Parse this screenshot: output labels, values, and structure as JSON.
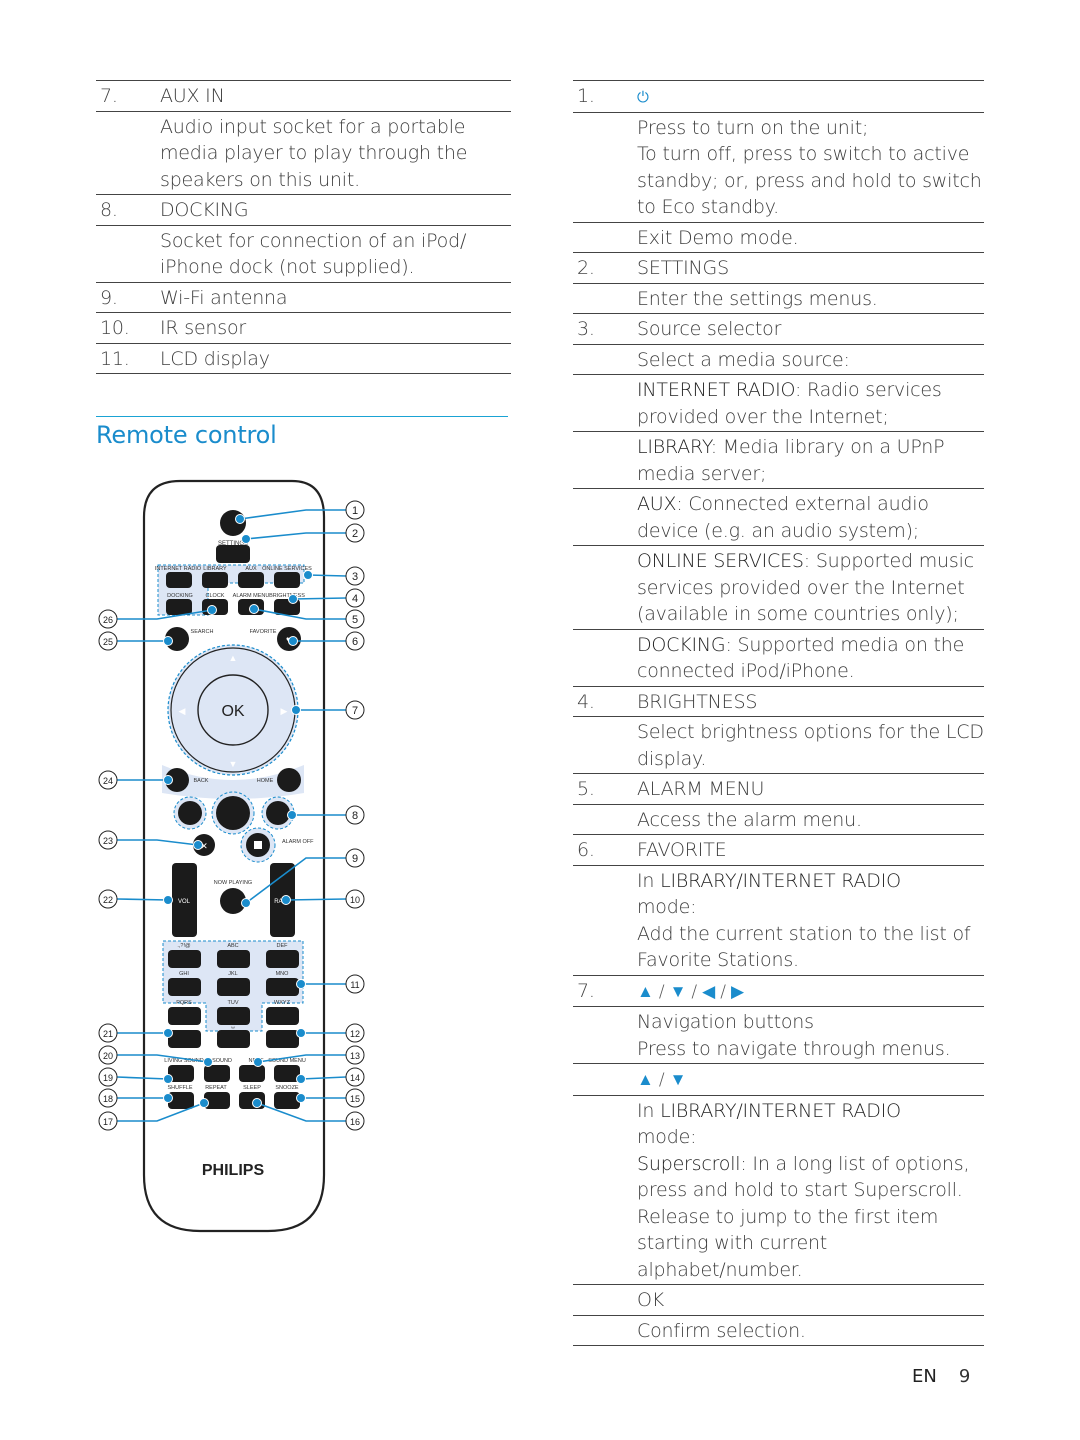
{
  "left_table": [
    {
      "num": "7.",
      "title": "AUX IN",
      "desc": [
        "Audio input socket for a portable",
        "media player to play through the",
        "speakers on this unit."
      ]
    },
    {
      "num": "8.",
      "title": "DOCKING",
      "desc": [
        "Socket for connection of an iPod/",
        "iPhone dock (not supplied)."
      ]
    },
    {
      "num": "9.",
      "title": "Wi-Fi antenna"
    },
    {
      "num": "10.",
      "title": "IR sensor"
    },
    {
      "num": "11.",
      "title": "LCD display"
    }
  ],
  "section": {
    "title": "Remote control"
  },
  "right_table": {
    "r1": {
      "num": "1.",
      "icon": "power-icon",
      "desc": [
        "Press to turn on the unit;",
        "To turn off, press to switch to active",
        "standby; or, press and hold to switch",
        "to Eco standby."
      ],
      "desc2": "Exit Demo mode."
    },
    "r2": {
      "num": "2.",
      "title": "SETTINGS",
      "desc": "Enter the settings menus."
    },
    "r3": {
      "num": "3.",
      "title": "Source selector",
      "desc": "Select a media source:",
      "sources": [
        {
          "key": "INTERNET RADIO",
          "text": ": Radio services",
          "text2": "provided over the Internet;"
        },
        {
          "key": "LIBRARY",
          "text": ": Media library on a UPnP",
          "text2": "media server;"
        },
        {
          "key": "AUX",
          "text": ": Connected external audio",
          "text2": "device (e.g. an audio system);"
        },
        {
          "key": "ONLINE SERVICES",
          "text": ": Supported music",
          "text2": "services provided over the Internet",
          "text3": "(available in some countries only);"
        },
        {
          "key": "DOCKING",
          "text": ": Supported media on the",
          "text2": "connected iPod/iPhone."
        }
      ]
    },
    "r4": {
      "num": "4.",
      "title": "BRIGHTNESS",
      "desc": [
        "Select brightness options for the LCD",
        "display."
      ]
    },
    "r5": {
      "num": "5.",
      "title": "ALARM MENU",
      "desc": "Access the alarm menu."
    },
    "r6": {
      "num": "6.",
      "title": "FAVORITE",
      "in": "In ",
      "mode_key": "LIBRARY/INTERNET RADIO",
      "mode": "mode:",
      "desc": [
        "Add the current station to the list of",
        "Favorite Stations."
      ]
    },
    "r7": {
      "num": "7.",
      "arrows": [
        "▲",
        "▼",
        "◀",
        "▶"
      ],
      "sep": " / ",
      "desc": [
        "Navigation buttons",
        "Press to navigate through menus."
      ],
      "sub_arrows": [
        "▲",
        "▼"
      ],
      "in": "In ",
      "mode_key": "LIBRARY/INTERNET RADIO",
      "mode": "mode:",
      "superscroll_key": "Superscroll",
      "superscroll": ": In a long list of options,",
      "superscroll_more": [
        "press and hold to start Superscroll.",
        "Release to jump to the first item",
        "starting with current alphabet/number."
      ]
    },
    "ok": {
      "title": "OK",
      "desc": "Confirm selection."
    }
  },
  "remote": {
    "brand": "PHILIPS",
    "ok_label": "OK",
    "labels": {
      "settings": "SETTINGS",
      "internet_radio": "INTERNET RADIO",
      "library": "LIBRARY",
      "aux": "AUX",
      "online_services": "ONLINE SERVICES",
      "docking": "DOCKING",
      "clock": "CLOCK",
      "alarm_menu": "ALARM MENU",
      "brightness": "BRIGHTNESS",
      "search": "SEARCH",
      "favorite": "FAVORITE",
      "back": "BACK",
      "home": "HOME",
      "alarm_off": "ALARM OFF",
      "now_playing": "NOW PLAYING",
      "vol": "VOL",
      "rate": "RATE",
      "k1": ".,?!@",
      "k2": "ABC",
      "k3": "DEF",
      "k4": "GHI",
      "k5": "JKL",
      "k6": "MNO",
      "k7": "PQRS",
      "k8": "TUV",
      "k9": "WXYZ",
      "space": "␣",
      "living_sound": "LIVING SOUND",
      "sound": "SOUND",
      "neut": "NEUT",
      "sound_menu": "SOUND MENU",
      "shuffle": "SHUFFLE",
      "repeat": "REPEAT",
      "sleep": "SLEEP",
      "snooze": "SNOOZE"
    },
    "callouts": [
      "1",
      "2",
      "3",
      "4",
      "5",
      "6",
      "7",
      "8",
      "9",
      "10",
      "11",
      "12",
      "13",
      "14",
      "15",
      "16",
      "17",
      "18",
      "19",
      "20",
      "21",
      "22",
      "23",
      "24",
      "25",
      "26"
    ],
    "accent": "#1a8ccc",
    "highlight": "#dde6f5"
  },
  "footer": {
    "lang": "EN",
    "page": "9"
  }
}
